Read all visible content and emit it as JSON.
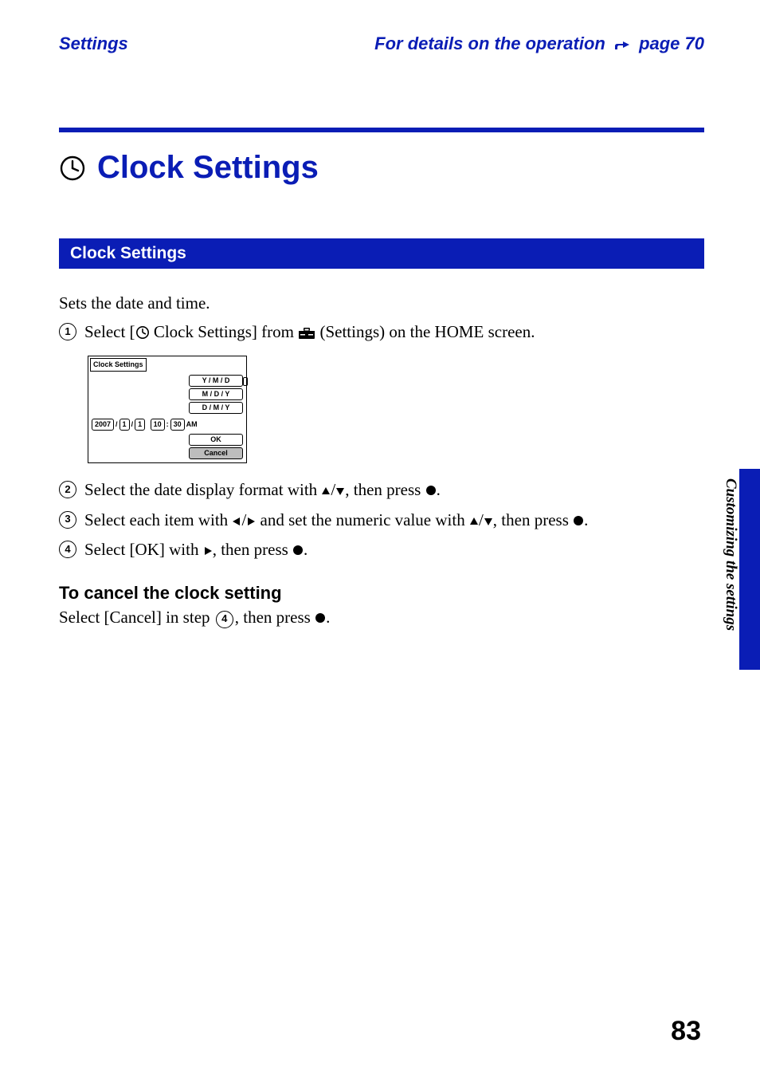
{
  "header": {
    "section": "Settings",
    "crossref_prefix": "For details on the operation ",
    "crossref_page_label": " page 70"
  },
  "title": "Clock Settings",
  "section_heading": "Clock Settings",
  "intro": "Sets the date and time.",
  "steps": {
    "s1_a": "Select [",
    "s1_b": " Clock Settings] from ",
    "s1_c": " (Settings) on the HOME screen.",
    "s2_a": "Select the date display format with ",
    "s2_b": ", then press ",
    "s2_c": ".",
    "s3_a": "Select each item with ",
    "s3_b": " and set the numeric value with ",
    "s3_c": ", then press ",
    "s3_d": ".",
    "s4_a": "Select [OK] with ",
    "s4_b": ", then press ",
    "s4_c": "."
  },
  "screenshot": {
    "title": "Clock Settings",
    "formats": [
      "Y / M / D",
      "M / D / Y",
      "D / M / Y"
    ],
    "year": "2007",
    "month": "1",
    "day": "1",
    "hour": "10",
    "minute": "30",
    "ampm": "AM",
    "ok": "OK",
    "cancel": "Cancel"
  },
  "cancel_heading": "To cancel the clock setting",
  "cancel_body_a": "Select [Cancel] in step ",
  "cancel_body_b": ", then press ",
  "cancel_body_c": ".",
  "side_tab": "Customizing the settings",
  "page_number": "83"
}
